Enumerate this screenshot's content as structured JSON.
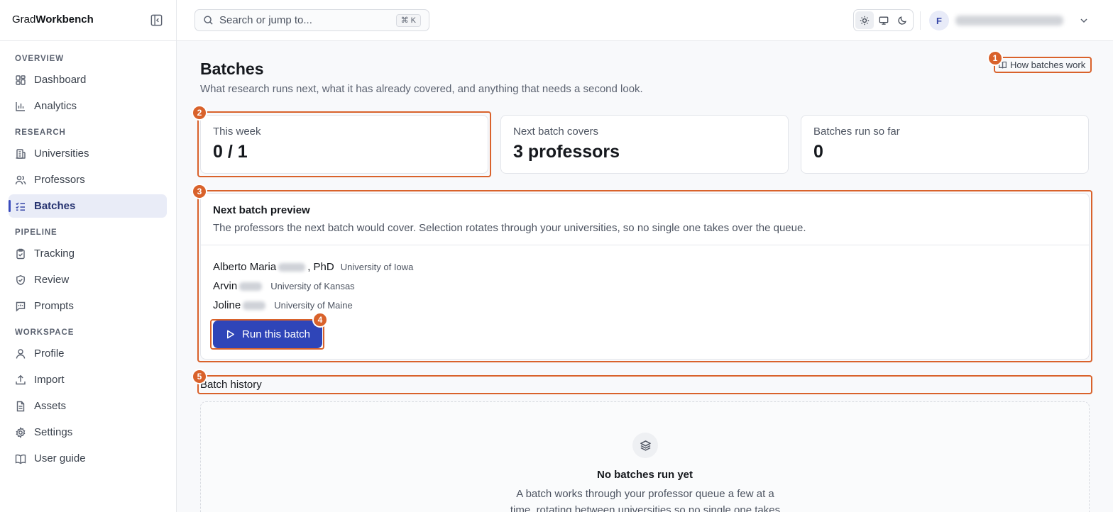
{
  "app": {
    "brand_prefix": "Grad",
    "brand_suffix": "Workbench"
  },
  "sidebar": {
    "sections": [
      {
        "title": "OVERVIEW",
        "items": [
          {
            "label": "Dashboard",
            "icon": "dashboard-icon",
            "active": false
          },
          {
            "label": "Analytics",
            "icon": "analytics-icon",
            "active": false
          }
        ]
      },
      {
        "title": "RESEARCH",
        "items": [
          {
            "label": "Universities",
            "icon": "university-icon",
            "active": false
          },
          {
            "label": "Professors",
            "icon": "people-icon",
            "active": false
          },
          {
            "label": "Batches",
            "icon": "checklist-icon",
            "active": true
          }
        ]
      },
      {
        "title": "PIPELINE",
        "items": [
          {
            "label": "Tracking",
            "icon": "clipboard-icon",
            "active": false
          },
          {
            "label": "Review",
            "icon": "shield-icon",
            "active": false
          },
          {
            "label": "Prompts",
            "icon": "message-icon",
            "active": false
          }
        ]
      },
      {
        "title": "WORKSPACE",
        "items": [
          {
            "label": "Profile",
            "icon": "user-icon",
            "active": false
          },
          {
            "label": "Import",
            "icon": "upload-icon",
            "active": false
          },
          {
            "label": "Assets",
            "icon": "file-icon",
            "active": false
          },
          {
            "label": "Settings",
            "icon": "gear-icon",
            "active": false
          },
          {
            "label": "User guide",
            "icon": "book-icon",
            "active": false
          }
        ]
      }
    ]
  },
  "topbar": {
    "search_placeholder": "Search or jump to...",
    "search_shortcut": "⌘ K",
    "theme_active": "light",
    "avatar_initial": "F"
  },
  "page": {
    "title": "Batches",
    "subtitle": "What research runs next, what it has already covered, and anything that needs a second look.",
    "help_link": "How batches work"
  },
  "stats": [
    {
      "label": "This week",
      "value": "0 / 1"
    },
    {
      "label": "Next batch covers",
      "value": "3 professors"
    },
    {
      "label": "Batches run so far",
      "value": "0"
    }
  ],
  "preview": {
    "title": "Next batch preview",
    "description": "The professors the next batch would cover. Selection rotates through your universities, so no single one takes over the queue.",
    "professors": [
      {
        "first_name": "Alberto Maria",
        "suffix": ", PhD",
        "university": "University of Iowa"
      },
      {
        "first_name": "Arvin",
        "suffix": "",
        "university": "University of Kansas"
      },
      {
        "first_name": "Joline",
        "suffix": "",
        "university": "University of Maine"
      }
    ],
    "run_button": "Run this batch"
  },
  "history": {
    "title": "Batch history",
    "empty_title": "No batches run yet",
    "empty_description": "A batch works through your professor queue a few at a time, rotating between universities so no single one takes"
  },
  "annotations": [
    "1",
    "2",
    "3",
    "4",
    "5"
  ],
  "colors": {
    "accent": "#2f45b8",
    "annotation": "#d9622b",
    "active_nav_bg": "#e9ecf7"
  }
}
